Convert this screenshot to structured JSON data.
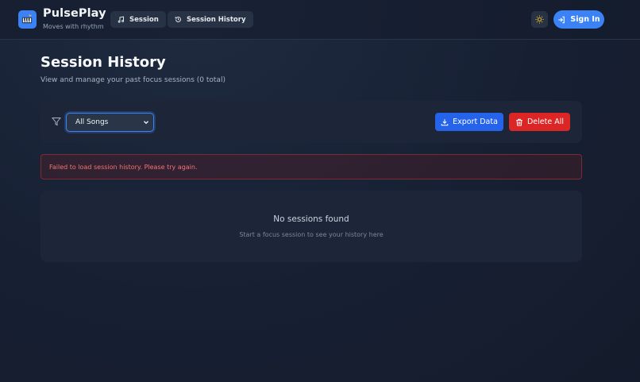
{
  "app": {
    "name": "PulsePlay",
    "tagline": "Moves with rhythm",
    "logo_icon": "piano-icon"
  },
  "nav": {
    "session": {
      "label": "Session",
      "icon": "music-note-icon"
    },
    "history": {
      "label": "Session History",
      "icon": "history-icon"
    },
    "theme_icon": "sun-icon",
    "signin": {
      "label": "Sign In",
      "icon": "sign-in-icon"
    }
  },
  "page": {
    "title": "Session History",
    "subtitle": "View and manage your past focus sessions (0 total)"
  },
  "filter": {
    "icon": "filter-icon",
    "selected": "All Songs",
    "export_label": "Export Data",
    "delete_label": "Delete All"
  },
  "error": {
    "message": "Failed to load session history. Please try again."
  },
  "empty": {
    "title": "No sessions found",
    "hint": "Start a focus session to see your history here"
  },
  "colors": {
    "accent": "#3b82f6",
    "danger": "#dc2626",
    "background": "#172033"
  }
}
